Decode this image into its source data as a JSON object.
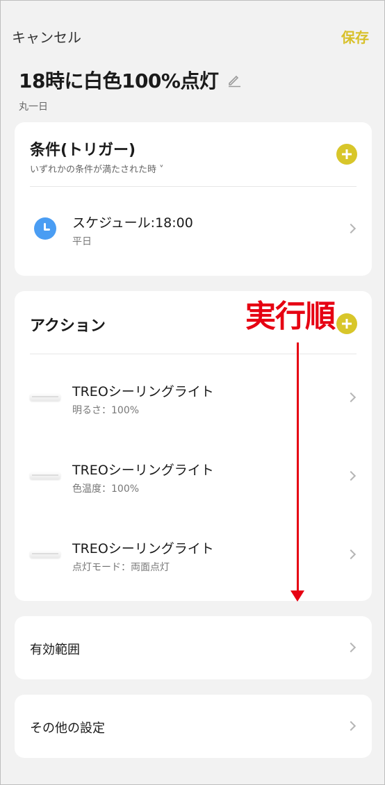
{
  "header": {
    "cancel_label": "キャンセル",
    "save_label": "保存"
  },
  "scene": {
    "title": "18時に白色100%点灯",
    "schedule_scope": "丸一日"
  },
  "conditions": {
    "title": "条件(トリガー)",
    "match_mode": "いずれかの条件が満たされた時 ˅",
    "items": [
      {
        "icon": "clock-icon",
        "label": "スケジュール:18:00",
        "detail": "平日"
      }
    ]
  },
  "actions": {
    "title": "アクション",
    "items": [
      {
        "icon": "ceiling-light-icon",
        "label": "TREOシーリングライト",
        "detail": "明るさ：100%"
      },
      {
        "icon": "ceiling-light-icon",
        "label": "TREOシーリングライト",
        "detail": "色温度：100%"
      },
      {
        "icon": "ceiling-light-icon",
        "label": "TREOシーリングライト",
        "detail": "点灯モード：両面点灯"
      }
    ]
  },
  "effective_range": {
    "label": "有効範囲"
  },
  "other_settings": {
    "label": "その他の設定"
  },
  "annotation": {
    "text": "実行順"
  },
  "colors": {
    "accent": "#d8c62a",
    "annotation": "#e60012",
    "clock": "#4a9df3"
  }
}
